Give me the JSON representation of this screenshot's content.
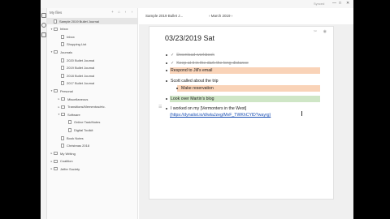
{
  "window": {
    "status": "Synced",
    "controls": [
      "—",
      "□",
      "✕"
    ]
  },
  "sidebar": {
    "title": "My files",
    "buttons": [
      "+",
      "⌂",
      "‹",
      "›"
    ],
    "items": [
      {
        "label": "Sample 2019 Bullet Journal",
        "level": 0,
        "kind": "doc",
        "selected": true,
        "caret": ""
      },
      {
        "label": "Inbox",
        "level": 0,
        "kind": "folder",
        "caret": "▾"
      },
      {
        "label": "Inbox",
        "level": 1,
        "kind": "doc",
        "caret": ""
      },
      {
        "label": "Shopping List",
        "level": 1,
        "kind": "doc",
        "caret": ""
      },
      {
        "label": "Journals",
        "level": 0,
        "kind": "folder",
        "caret": "▾"
      },
      {
        "label": "2020 Bullet Journal",
        "level": 1,
        "kind": "doc",
        "caret": ""
      },
      {
        "label": "2019 Bullet Journal",
        "level": 1,
        "kind": "doc",
        "caret": ""
      },
      {
        "label": "2018 Bullet Journal",
        "level": 1,
        "kind": "doc",
        "caret": ""
      },
      {
        "label": "2017 Bullet Journal",
        "level": 1,
        "kind": "doc",
        "caret": ""
      },
      {
        "label": "Personal",
        "level": 0,
        "kind": "folder",
        "caret": "▾"
      },
      {
        "label": "Miscellaneous",
        "level": 1,
        "kind": "folder",
        "caret": "▸"
      },
      {
        "label": "Transitions/Mementos/etc.",
        "level": 1,
        "kind": "folder",
        "caret": "▸"
      },
      {
        "label": "Software",
        "level": 1,
        "kind": "folder",
        "caret": "▾"
      },
      {
        "label": "Online Task/Notes",
        "level": 2,
        "kind": "doc",
        "caret": ""
      },
      {
        "label": "Digital Toolkit",
        "level": 2,
        "kind": "doc",
        "caret": ""
      },
      {
        "label": "Book Notes",
        "level": 1,
        "kind": "doc",
        "caret": ""
      },
      {
        "label": "Christmas 2018",
        "level": 1,
        "kind": "doc",
        "caret": ""
      },
      {
        "label": "My Writing",
        "level": 0,
        "kind": "folder",
        "caret": "▸"
      },
      {
        "label": "Coalition",
        "level": 0,
        "kind": "folder",
        "caret": "▸"
      },
      {
        "label": "Jeffer Society",
        "level": 0,
        "kind": "folder",
        "caret": "▸"
      }
    ]
  },
  "breadcrumb": {
    "doc": "Sample 2019 Bullet J...",
    "sep": "›",
    "node": "March 2019",
    "node_caret": "›"
  },
  "document": {
    "title": "03/23/2019 Sat",
    "tools": "✂ ◉",
    "bullets": [
      {
        "text": "Download workbook",
        "done": true
      },
      {
        "text": "Keep at it in the dark the long-distance",
        "done": true
      },
      {
        "text": "Respond to Jill's email",
        "highlight": "#f9d3b8"
      },
      {
        "text": "Scott called about the trip"
      },
      {
        "text": "Make reservation",
        "highlight": "#f9d3b8",
        "sub": true
      },
      {
        "text": "Look over Martin's blog",
        "highlight": "#cfe6c6"
      },
      {
        "text": "I worked on my [Vermonters in the West]"
      },
      {
        "link": "(https://dynalist.io/d/wlaJzeg/MvF_TWKhCYlD?wayrg)"
      }
    ],
    "row_handle": "☰"
  },
  "colors": {
    "highlight_orange": "#f9d3b8",
    "highlight_green": "#cfe6c6",
    "link": "#1a4fb4"
  }
}
